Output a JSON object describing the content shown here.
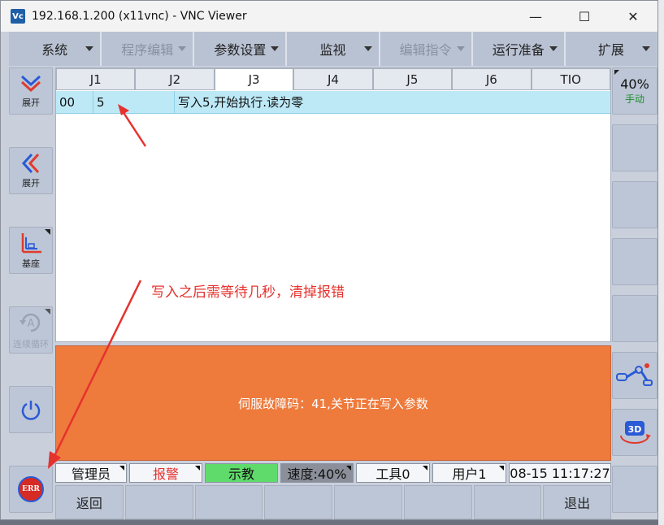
{
  "window": {
    "title": "192.168.1.200 (x11vnc) - VNC Viewer",
    "icon_text": "Vc"
  },
  "window_controls": {
    "minimize": "—",
    "maximize": "☐",
    "close": "✕"
  },
  "menu": [
    {
      "label": "系统",
      "enabled": true
    },
    {
      "label": "程序编辑",
      "enabled": false
    },
    {
      "label": "参数设置",
      "enabled": true
    },
    {
      "label": "监视",
      "enabled": true
    },
    {
      "label": "编辑指令",
      "enabled": false
    },
    {
      "label": "运行准备",
      "enabled": true
    },
    {
      "label": "扩展",
      "enabled": true
    }
  ],
  "left_buttons": [
    {
      "label": "展开",
      "icon": "chevron-down-icon"
    },
    {
      "label": "展开",
      "icon": "chevron-left-icon"
    },
    {
      "label": "基座",
      "icon": "coordinate-axes-icon"
    },
    {
      "label": "连续循环",
      "icon": "cycle-a-icon"
    },
    {
      "label": "",
      "icon": "power-icon"
    },
    {
      "label": "",
      "icon": "err-icon",
      "icon_text": "ERR"
    }
  ],
  "tabs": [
    "J1",
    "J2",
    "J3",
    "J4",
    "J5",
    "J6",
    "TIO"
  ],
  "active_tab": "J3",
  "table_row": {
    "code": "00",
    "value": "5",
    "message": "写入5,开始执行.读为零"
  },
  "servo_message": "伺服故障码：41,关节正在写入参数",
  "status_bar": {
    "role": "管理员",
    "alarm": "报警",
    "mode": "示教",
    "speed": "速度:40%",
    "tool": "工具0",
    "user": "用户1",
    "datetime": "08-15 11:17:27"
  },
  "bottom_buttons": {
    "back": "返回",
    "exit": "退出"
  },
  "right_panel": {
    "speed": "40%",
    "mode": "手动"
  },
  "right_icons": [
    "robot-arm-icon",
    "3d-view-icon"
  ],
  "annotation": {
    "text": "写入之后需等待几秒，清掉报错"
  },
  "colors": {
    "alarm_text": "#e5322d",
    "mode_bg": "#5fdb6b",
    "speed_bg": "#8a8f99",
    "message_bg": "#ee7a3c",
    "row_bg": "#bde9f7",
    "annotation": "#e5322d",
    "mode_text": "#1c8e2a"
  }
}
